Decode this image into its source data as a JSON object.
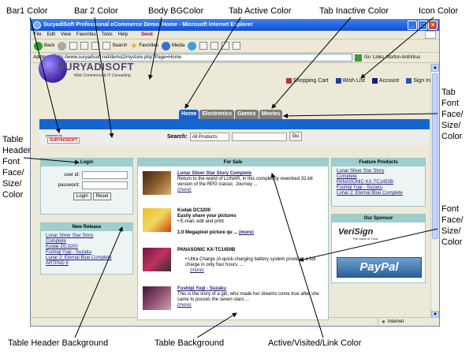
{
  "callouts": {
    "bar1": "Bar1 Color",
    "bar2": "Bar 2 Color",
    "body_bg": "Body BGColor",
    "tab_active": "Tab Active Color",
    "tab_inactive": "Tab Inactive Color",
    "icon_color": "Icon Color",
    "tab_font": [
      "Tab",
      "Font",
      "Face/",
      "Size/",
      "Color"
    ],
    "table_header_font": [
      "Table",
      "Header",
      "Font",
      "Face/",
      "Size/",
      "Color"
    ],
    "font_face": [
      "Font",
      "Face/",
      "Size/",
      "Color"
    ],
    "table_header_bg": "Table Header Background",
    "table_bg": "Table Background",
    "link_color": "Active/Visited/Link Color"
  },
  "browser": {
    "title": "SuryadiSoft Professional eCommerce Demo, Home - Microsoft Internet Explorer",
    "menu": [
      "File",
      "Edit",
      "View",
      "Favorites",
      "Tools",
      "Help"
    ],
    "send_label": "Send",
    "toolbar": {
      "back": "Back",
      "search": "Search",
      "favorites": "Favorites",
      "media": "Media"
    },
    "address_label": "Address",
    "address": "http://www.suryadisoft.net/demo2/mystore.php?Page=Home",
    "go": "Go",
    "links": "Links",
    "norton": "Norton AntiVirus",
    "status_zone": "Internet"
  },
  "page": {
    "logo_name": "SURYADISOFT",
    "logo_tag": "Web Commerce & IT Consulting",
    "top_links": [
      "Shopping Cart",
      "Wish List",
      "Account",
      "Sign In"
    ],
    "tabs": [
      {
        "label": "Home",
        "active": true
      },
      {
        "label": "Electronics",
        "active": false
      },
      {
        "label": "Games",
        "active": false
      },
      {
        "label": "Movies",
        "active": false
      }
    ],
    "powered_by": "powered by",
    "powered_logo": "SURYADISOFT",
    "search_label": "Search:",
    "search_select": "All Products",
    "search_go": "Go",
    "login": {
      "header": "Login",
      "user_label": "user id:",
      "password_label": "password:",
      "login_btn": "Login",
      "reset_btn": "Reset"
    },
    "new_release": {
      "header": "New Release",
      "items": [
        "Lunar Silver Star Story",
        "Complete",
        "Kodak DC3200",
        "Fushigi Yugi - Suzaku",
        "Lunar 2: Eternal Blue Complete",
        "ARTPAD II"
      ]
    },
    "for_sale": {
      "header": "For Sale",
      "products": [
        {
          "title": "Lunar Silver Star Story Complete",
          "desc": "Return to the world of LUNAR, in this completely reworked 32-bit version of the RPG classic. Journey ...",
          "more": "(more)"
        },
        {
          "title": "Kodak DC3200",
          "desc1": "Easily share your pictures",
          "desc2": "E-mail, edit and print",
          "desc3": "1.0 Megapixel picture qu ...",
          "more": "(more)"
        },
        {
          "title": "PANASONIC KX-TC1450B",
          "desc": "Ultra Charge (A quick-charging battery system provides a full charge in only four hours. ...",
          "more": "(more)"
        },
        {
          "title": "Fushigi Yugi - Suzaku",
          "desc": "This is the story of a girl, who made her dreams come true after she came to posses the seven stars ...",
          "more": "(more)"
        }
      ]
    },
    "feature": {
      "header": "Feature Products",
      "items": [
        "Lunar Silver Star Story",
        "Complete",
        "PANASONIC KX-TC1450B",
        "Fushigi Yugi - Suzaku",
        "Lunar 2: Eternal Blue Complete"
      ]
    },
    "sponsor": {
      "header": "Our Sponsor",
      "verisign": "VeriSign",
      "verisign_tag": "The Value of Trust",
      "paypal": "PayPal"
    }
  },
  "colors": {
    "tab_active": "#1a5fc4",
    "tab_inactive": "#7d7d7d",
    "bar1": "#1565d0",
    "bar2": "#ededed",
    "table_header_bg": "#9ecfcf",
    "table_bg": "#ecf4f4",
    "link": "#1d1d7a"
  }
}
